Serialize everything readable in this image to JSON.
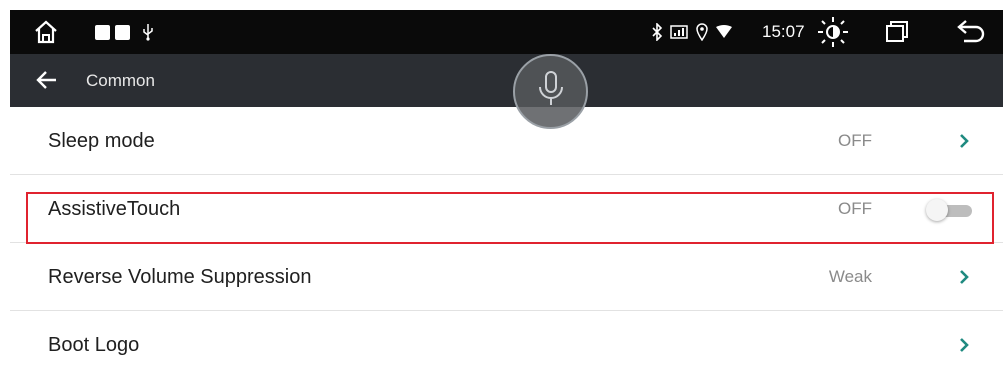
{
  "status_bar": {
    "time": "15:07",
    "icons": [
      "home-icon",
      "app-icon",
      "app-icon",
      "usb-icon",
      "bluetooth-icon",
      "signal-icon",
      "location-icon",
      "wifi-icon",
      "brightness-icon",
      "recent-apps-icon",
      "back-icon"
    ]
  },
  "header": {
    "title": "Common",
    "back_icon": "back-arrow-icon",
    "mic_icon": "microphone-icon"
  },
  "settings": {
    "items": [
      {
        "label": "Sleep mode",
        "value": "OFF",
        "control": "chevron"
      },
      {
        "label": "AssistiveTouch",
        "value": "OFF",
        "control": "toggle",
        "enabled": false,
        "highlighted": true
      },
      {
        "label": "Reverse Volume Suppression",
        "value": "Weak",
        "control": "chevron"
      },
      {
        "label": "Boot Logo",
        "value": "",
        "control": "chevron"
      }
    ]
  },
  "colors": {
    "status_bar_bg": "#0a0a0a",
    "header_bg": "#2b2e33",
    "chevron": "#1f8a80",
    "highlight_border": "#e0232f"
  }
}
